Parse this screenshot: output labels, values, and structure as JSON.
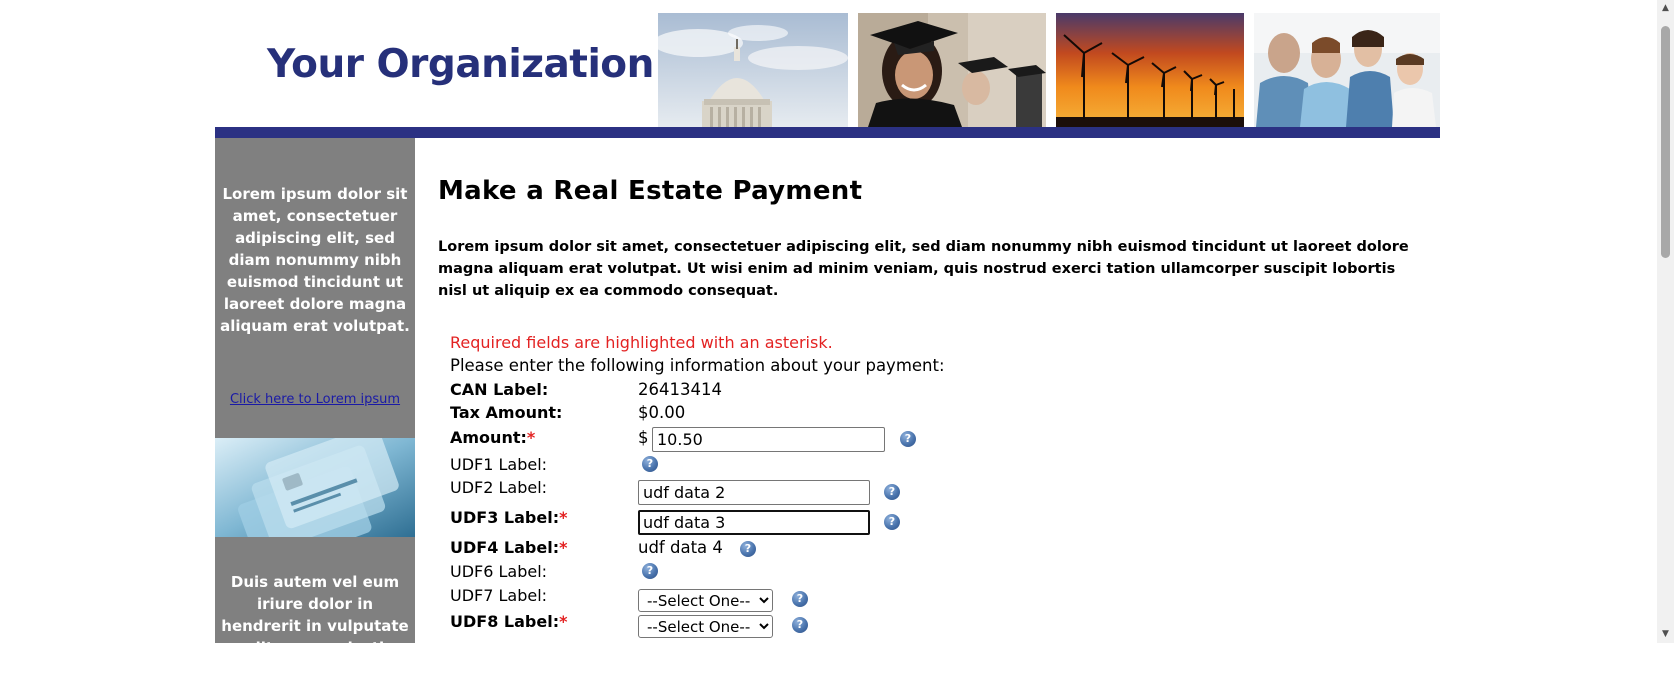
{
  "header": {
    "org_name": "Your Organization",
    "photos": [
      "capitol-dome-photo",
      "graduate-photo",
      "wind-turbines-photo",
      "family-doctor-photo"
    ],
    "bar_color": "#2b3183"
  },
  "sidebar": {
    "text_top": "Lorem ipsum dolor sit amet, consectetuer adipiscing elit, sed diam nonummy nibh euismod tincidunt ut laoreet dolore magna aliquam erat volutpat.",
    "link_label": "Click here to Lorem ipsum",
    "text_bottom": "Duis autem vel eum iriure dolor in hendrerit in vulputate velit esse molestie consequat"
  },
  "main": {
    "title": "Make a Real Estate Payment",
    "intro": "Lorem ipsum dolor sit amet, consectetuer adipiscing elit, sed diam nonummy nibh euismod tincidunt ut laoreet dolore magna aliquam erat volutpat. Ut wisi enim ad minim veniam, quis nostrud exerci tation ullamcorper suscipit lobortis nisl ut aliquip ex ea commodo consequat."
  },
  "form": {
    "required_note": "Required fields are highlighted with an asterisk.",
    "info_line": "Please enter the following information about your payment:",
    "asterisk": "*",
    "can": {
      "label": "CAN Label:",
      "value": "26413414"
    },
    "tax": {
      "label": "Tax Amount:",
      "value": "$0.00"
    },
    "amount": {
      "label": "Amount:",
      "currency": "$",
      "value": "10.50"
    },
    "udf1": {
      "label": "UDF1 Label:"
    },
    "udf2": {
      "label": "UDF2 Label:",
      "value": "udf data 2"
    },
    "udf3": {
      "label": "UDF3 Label:",
      "value": "udf data 3"
    },
    "udf4": {
      "label": "UDF4 Label:",
      "value": "udf data 4"
    },
    "udf6": {
      "label": "UDF6 Label:"
    },
    "udf7": {
      "label": "UDF7 Label:",
      "selected": "--Select One--"
    },
    "udf8": {
      "label": "UDF8 Label:",
      "selected": "--Select One--"
    },
    "help_glyph": "?"
  },
  "colors": {
    "accent": "#2b3183",
    "org_text": "#26307a",
    "sidebar_bg": "#808080",
    "required": "#e32222",
    "link": "#1a1aa6"
  }
}
